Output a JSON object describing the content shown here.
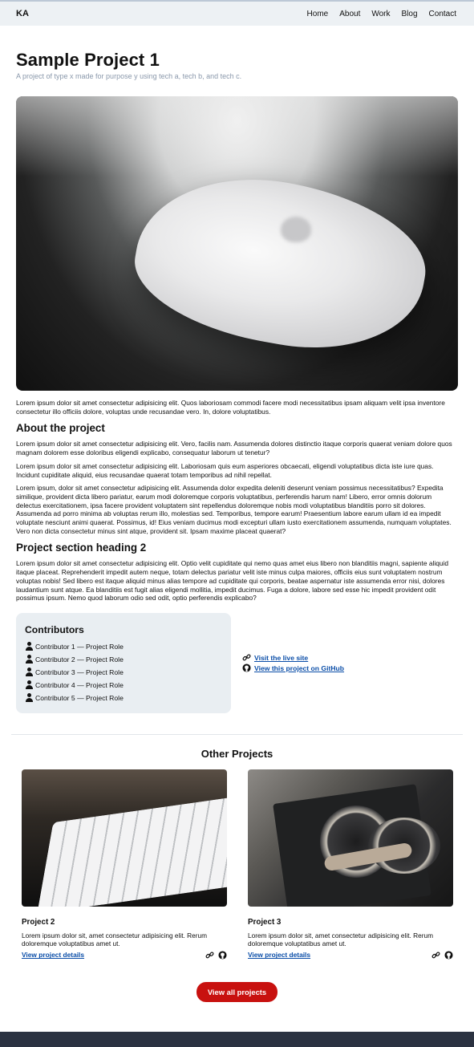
{
  "header": {
    "brand": "KA",
    "nav": [
      "Home",
      "About",
      "Work",
      "Blog",
      "Contact"
    ]
  },
  "page": {
    "title": "Sample Project 1",
    "subtitle": "A project of type x made for purpose y using tech a, tech b, and tech c.",
    "intro": "Lorem ipsum dolor sit amet consectetur adipisicing elit. Quos laboriosam commodi facere modi necessitatibus ipsam aliquam velit ipsa inventore consectetur illo officiis dolore, voluptas unde recusandae vero. In, dolore voluptatibus.",
    "section1_title": "About the project",
    "section1_paragraphs": [
      "Lorem ipsum dolor sit amet consectetur adipisicing elit. Vero, facilis nam. Assumenda dolores distinctio itaque corporis quaerat veniam dolore quos magnam dolorem esse doloribus eligendi explicabo, consequatur laborum ut tenetur?",
      "Lorem ipsum dolor sit amet consectetur adipisicing elit. Laboriosam quis eum asperiores obcaecati, eligendi voluptatibus dicta iste iure quas. Incidunt cupiditate aliquid, eius recusandae quaerat totam temporibus ad nihil repellat.",
      "Lorem ipsum, dolor sit amet consectetur adipisicing elit. Assumenda dolor expedita deleniti deserunt veniam possimus necessitatibus? Expedita similique, provident dicta libero pariatur, earum modi doloremque corporis voluptatibus, perferendis harum nam! Libero, error omnis dolorum delectus exercitationem, ipsa facere provident voluptatem sint repellendus doloremque nobis modi voluptatibus blanditiis porro sit dolores. Assumenda ad porro minima ab voluptas rerum illo, molestias sed. Temporibus, tempore earum! Praesentium labore earum ullam id ea impedit voluptate nesciunt animi quaerat. Possimus, id! Eius veniam ducimus modi excepturi ullam iusto exercitationem assumenda, numquam voluptates. Vero non dicta consectetur minus sint atque, provident sit. Ipsam maxime placeat quaerat?"
    ],
    "section2_title": "Project section heading 2",
    "section2_paragraph": "Lorem ipsum dolor sit amet consectetur adipisicing elit. Optio velit cupiditate qui nemo quas amet eius libero non blanditiis magni, sapiente aliquid itaque placeat. Reprehenderit impedit autem neque, totam delectus pariatur velit iste minus culpa maiores, officiis eius sunt voluptatem nostrum voluptas nobis! Sed libero est itaque aliquid minus alias tempore ad cupiditate qui corporis, beatae aspernatur iste assumenda error nisi, dolores laudantium sunt atque. Ea blanditiis est fugit alias eligendi mollitia, impedit ducimus. Fuga a dolore, labore sed esse hic impedit provident odit possimus ipsum. Nemo quod laborum odio sed odit, optio perferendis explicabo?"
  },
  "contributors": {
    "title": "Contributors",
    "items": [
      "Contributor 1 — Project Role",
      "Contributor 2 — Project Role",
      "Contributor 3 — Project Role",
      "Contributor 4 — Project Role",
      "Contributor 5 — Project Role"
    ]
  },
  "links": {
    "live": "Visit the live site",
    "github": "View this project on GitHub"
  },
  "other_projects": {
    "title": "Other Projects",
    "cards": [
      {
        "title": "Project 2",
        "desc": "Lorem ipsum dolor sit, amet consectetur adipisicing elit. Rerum doloremque voluptatibus amet ut.",
        "link": "View project details"
      },
      {
        "title": "Project 3",
        "desc": "Lorem ipsum dolor sit, amet consectetur adipisicing elit. Rerum doloremque voluptatibus amet ut.",
        "link": "View project details"
      }
    ],
    "button": "View all projects"
  },
  "colors": {
    "accent_button": "#c8110f",
    "link": "#0b4ea8",
    "footer": "#2b3241"
  }
}
